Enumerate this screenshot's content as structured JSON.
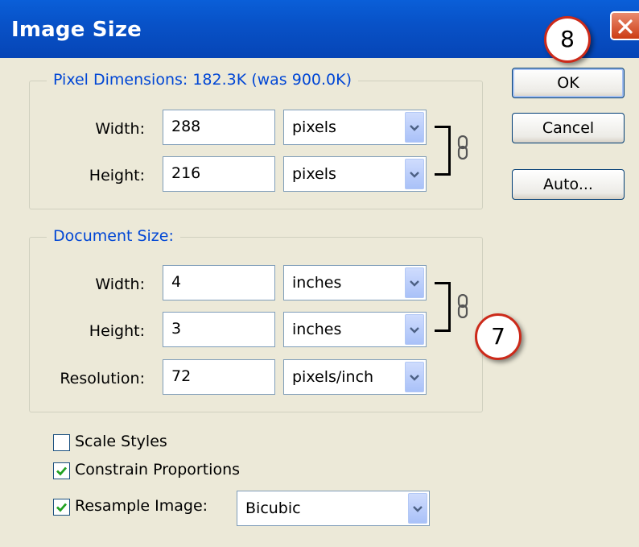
{
  "dialog": {
    "title": "Image Size"
  },
  "buttons": {
    "ok": "OK",
    "cancel": "Cancel",
    "auto": "Auto..."
  },
  "pixel_dimensions": {
    "legend": "Pixel Dimensions:  182.3K (was 900.0K)",
    "width_label": "Width:",
    "width_value": "288",
    "width_unit": "pixels",
    "height_label": "Height:",
    "height_value": "216",
    "height_unit": "pixels"
  },
  "document_size": {
    "legend": "Document Size:",
    "width_label": "Width:",
    "width_value": "4",
    "width_unit": "inches",
    "height_label": "Height:",
    "height_value": "3",
    "height_unit": "inches",
    "resolution_label": "Resolution:",
    "resolution_value": "72",
    "resolution_unit": "pixels/inch"
  },
  "options": {
    "scale_styles": {
      "label": "Scale Styles",
      "checked": false
    },
    "constrain_proportions": {
      "label": "Constrain Proportions",
      "checked": true
    },
    "resample_image": {
      "label": "Resample Image:",
      "checked": true,
      "method": "Bicubic"
    }
  },
  "callouts": {
    "ok_step": "8",
    "link_step": "7"
  },
  "colors": {
    "title_bar": "#0a5fd8",
    "dialog_bg": "#ece9d8",
    "legend_text": "#0046d5",
    "callout_border": "#cc2a1a"
  },
  "icons": {
    "chain_link": "chain-link-icon",
    "dropdown": "chevron-down-icon",
    "close": "close-icon",
    "check": "checkmark-icon"
  }
}
